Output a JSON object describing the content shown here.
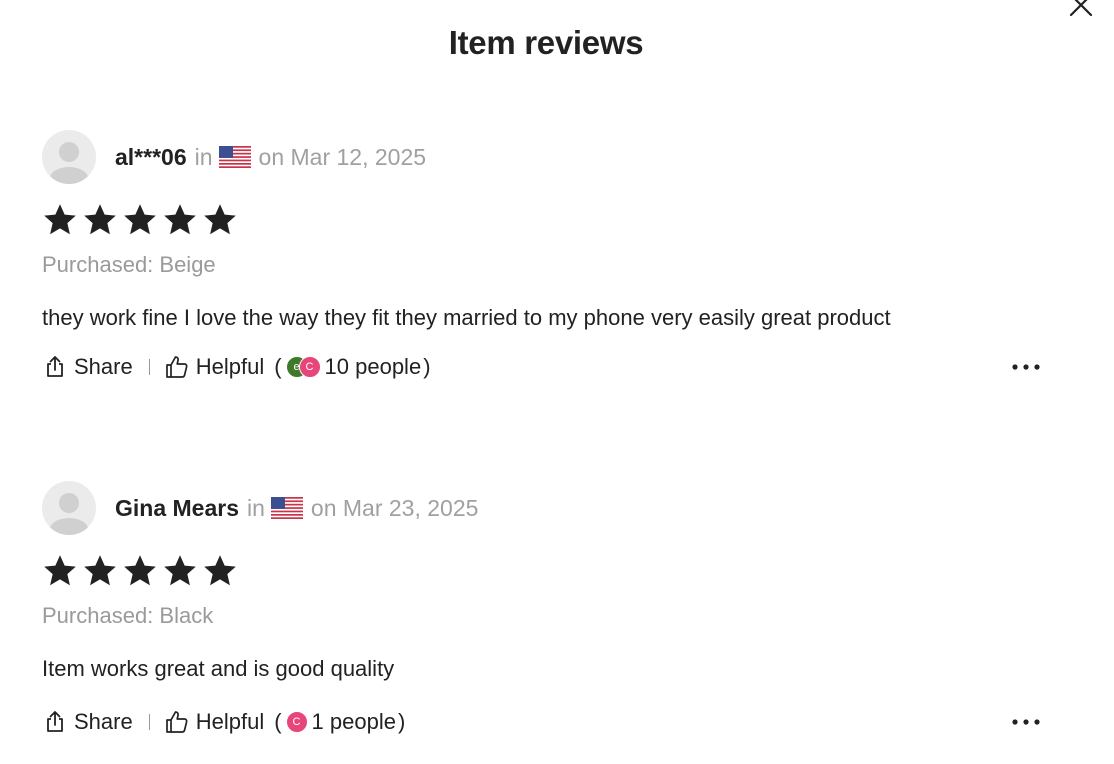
{
  "modal": {
    "title": "Item reviews"
  },
  "reviews": [
    {
      "reviewer": "al***06",
      "in_label": "in",
      "date": "on Mar 12, 2025",
      "rating": 5,
      "purchased": "Purchased: Beige",
      "text": "they work fine I love the way they fit they married to my phone very easily great product",
      "share_label": "Share",
      "helpful_label": "Helpful",
      "paren_open": "(",
      "paren_close": ")",
      "helpful_count": "10 people",
      "helpful_avatars": [
        {
          "initial": "e",
          "color": "#3f7a2a"
        },
        {
          "initial": "C",
          "color": "#e8457a"
        }
      ]
    },
    {
      "reviewer": "Gina Mears",
      "in_label": "in",
      "date": "on Mar 23, 2025",
      "rating": 5,
      "purchased": "Purchased: Black",
      "text": "Item works great and is good quality",
      "share_label": "Share",
      "helpful_label": "Helpful",
      "paren_open": "(",
      "paren_close": ")",
      "helpful_count": "1 people",
      "helpful_avatars": [
        {
          "initial": "C",
          "color": "#e8457a"
        }
      ]
    }
  ],
  "colors": {
    "text": "#222222",
    "muted": "#a0a0a0",
    "star": "#222222"
  }
}
